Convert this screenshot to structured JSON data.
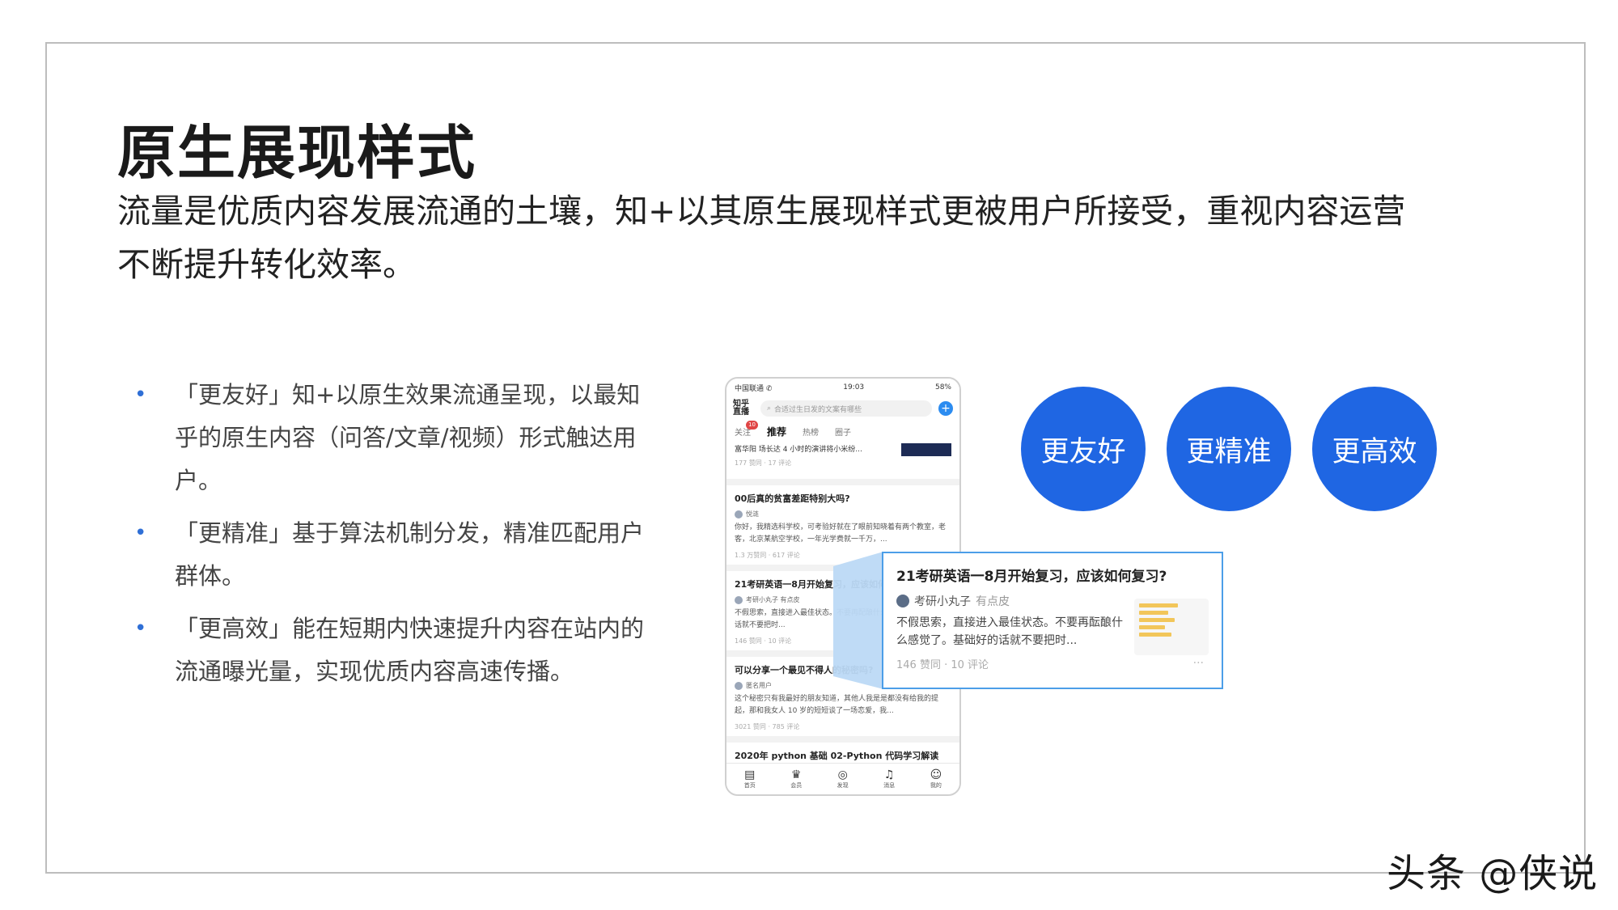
{
  "title": "原生展现样式",
  "subtitle": "流量是优质内容发展流通的土壤，知+以其原生展现样式更被用户所接受，重视内容运营不断提升转化效率。",
  "bullets": [
    {
      "text": "「更友好」知+以原生效果流通呈现，以最知乎的原生内容（问答/文章/视频）形式触达用户。"
    },
    {
      "text": "「更精准」基于算法机制分发，精准匹配用户群体。"
    },
    {
      "text": "「更高效」能在短期内快速提升内容在站内的流通曝光量，实现优质内容高速传播。"
    }
  ],
  "badges": [
    "更友好",
    "更精准",
    "更高效"
  ],
  "colors": {
    "accent": "#1f66e3",
    "bullet": "#2f6fd6",
    "highlight": "#4c9ee8"
  },
  "phone": {
    "status": {
      "carrier": "中国联通 ✆",
      "time": "19:03",
      "battery": "58%"
    },
    "logo": "知乎\n直播",
    "search_placeholder": "合适过生日发的文案有哪些",
    "tabs": [
      "关注",
      "推荐",
      "热榜",
      "圈子"
    ],
    "tab_badge": "10",
    "top_item": {
      "text": "富华阳 场长达 4 小时的演讲将小米纷...",
      "meta": "177 赞同 · 17 评论"
    },
    "cards": [
      {
        "title": "00后真的贫富差距特别大吗?",
        "author": "悦涟",
        "body": "你好，我精选科学校，可考验好就在了眼前知晓着有两个教室，老客，北京某航空学校，一年光学费就一千万，...",
        "meta": "1.3 万赞同 · 617 评论"
      },
      {
        "title": "21考研英语一8月开始复习，应该如何复习?",
        "author": "考研小丸子 有点皮",
        "body": "不假思索，直接进入最佳状态。不要再配酿什么感觉了。基础好的话就不要把时...",
        "meta": "146 赞同 · 10 评论"
      },
      {
        "title": "可以分享一个最见不得人的秘密吗?",
        "author": "匿名用户",
        "body": "这个秘密只有我最好的朋友知道，其他人我是是都没有给我的提起，那和我女人 10 岁的短短谈了一场恋爱，我...",
        "meta": "3021 赞同 · 785 评论"
      },
      {
        "title": "2020年 python 基础 02-Python 代码学习解读",
        "author": "",
        "body": "",
        "meta": ""
      }
    ],
    "nav": [
      {
        "icon": "▤",
        "label": "首页"
      },
      {
        "icon": "♛",
        "label": "会员"
      },
      {
        "icon": "◎",
        "label": "发现"
      },
      {
        "icon": "♫",
        "label": "消息"
      },
      {
        "icon": "☺",
        "label": "我的"
      }
    ]
  },
  "zoom_card": {
    "title": "21考研英语一8月开始复习，应该如何复习?",
    "author": "考研小丸子",
    "author_tag": "有点皮",
    "body": "不假思索，直接进入最佳状态。不要再酝酿什么感觉了。基础好的话就不要把时...",
    "meta": "146 赞同 · 10 评论",
    "more": "···"
  },
  "watermark": "头条 @侠说"
}
